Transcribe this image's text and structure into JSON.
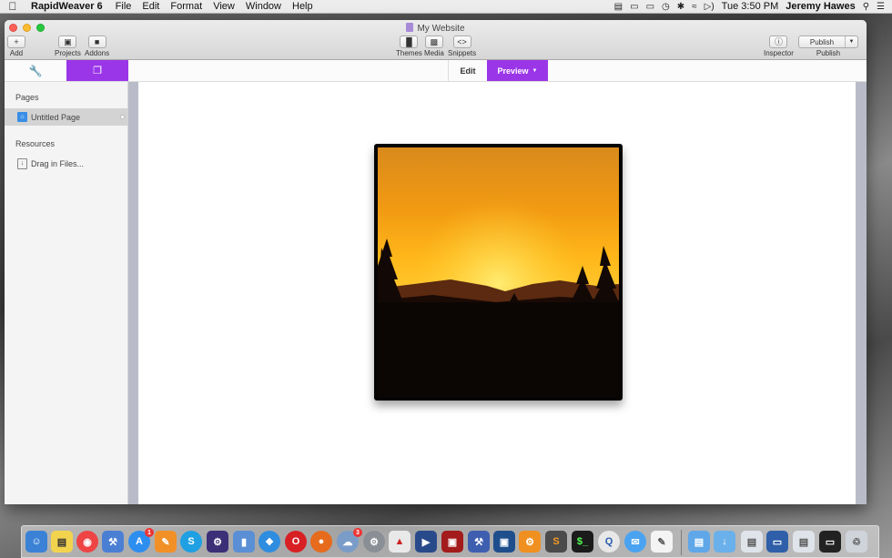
{
  "menubar": {
    "app_name": "RapidWeaver 6",
    "menus": [
      "File",
      "Edit",
      "Format",
      "View",
      "Window",
      "Help"
    ],
    "clock": "Tue 3:50 PM",
    "user": "Jeremy Hawes"
  },
  "window": {
    "title": "My Website",
    "toolbar": {
      "add": "Add",
      "projects": "Projects",
      "addons": "Addons",
      "themes": "Themes",
      "media": "Media",
      "snippets": "Snippets",
      "inspector": "Inspector",
      "publish_button": "Publish",
      "publish_label": "Publish"
    },
    "tabs": {
      "edit": "Edit",
      "preview": "Preview"
    }
  },
  "sidebar": {
    "pages_heading": "Pages",
    "page_item": "Untitled Page",
    "resources_heading": "Resources",
    "resources_item": "Drag in Files..."
  },
  "colors": {
    "accent": "#9b36e8"
  },
  "icons": {
    "tools_tab": "wrench-icon",
    "pages_tab": "pages-icon",
    "page_item": "home-icon",
    "resources_item": "drag-file-icon"
  },
  "dock": {
    "apps": [
      "Finder",
      "Stickies",
      "Chrome",
      "Xcode",
      "App Store",
      "Pages",
      "Skype",
      "Instruments",
      "Migration",
      "Safari",
      "Opera",
      "Firefox",
      "Cloud",
      "System Preferences",
      "Keynote",
      "iMovie",
      "Photo Booth",
      "Xcode Tools",
      "Remote",
      "Gear",
      "Sublime",
      "Terminal",
      "Quip",
      "Messages",
      "TextEdit"
    ],
    "badges": {
      "App Store": "1",
      "Cloud": "3"
    }
  }
}
